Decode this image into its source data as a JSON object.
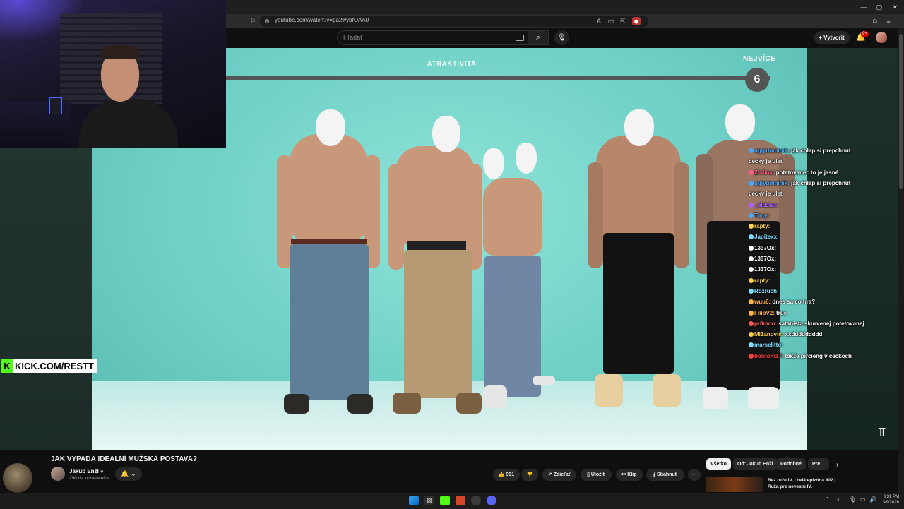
{
  "browser": {
    "url": "youtube.com/watch?v=ga2wybfOAA0",
    "window_controls": [
      "—",
      "▢",
      "✕"
    ]
  },
  "youtube": {
    "search_placeholder": "Hľadať",
    "create_label": "Vytvoriť",
    "notifications_badge": "9+"
  },
  "video": {
    "bar_label": "ATRAKTIVITA",
    "bar_top_label": "NEJVÍCE",
    "rank_number": "6",
    "title": "JAK VYPADÁ IDEÁLNÍ MUŽSKÁ POSTAVA?",
    "channel_name": "Jakub Enžl",
    "subscribers": "290 tis. odberateľov",
    "likes": "991",
    "actions": {
      "share": "Zdieľať",
      "save": "Uložiť",
      "clip": "Klip",
      "download": "Stiahnuť"
    }
  },
  "stream_overlay": {
    "kick_label": "KICK.COM/RESTT"
  },
  "chat": [
    {
      "user": "uglydominik:",
      "text": "jak chlap si prepchnut",
      "color": "#4aa8ff"
    },
    {
      "user": "",
      "text": "cecky je ulet",
      "color": "#ffffff"
    },
    {
      "user": "Ziolina:",
      "text": "potetovanec to je jasné",
      "color": "#ff5a8a"
    },
    {
      "user": "uglydominik:",
      "text": "jak chlap si prepchnut",
      "color": "#4aa8ff"
    },
    {
      "user": "",
      "text": "cecky je ulet",
      "color": "#ffffff"
    },
    {
      "user": "_oldstar:",
      "text": "",
      "color": "#b060ff"
    },
    {
      "user": "Tony:",
      "text": "",
      "color": "#4aa8ff"
    },
    {
      "user": "rapty:",
      "text": "",
      "color": "#ffd24a"
    },
    {
      "user": "Japitexx:",
      "text": "",
      "color": "#7fe0ff"
    },
    {
      "user": "1337Ox:",
      "text": "",
      "color": "#ffffff"
    },
    {
      "user": "1337Ox:",
      "text": "",
      "color": "#ffffff"
    },
    {
      "user": "1337Ox:",
      "text": "",
      "color": "#ffffff"
    },
    {
      "user": "rapty:",
      "text": "",
      "color": "#ffd24a"
    },
    {
      "user": "Rozruch:",
      "text": "",
      "color": "#7fe0ff"
    },
    {
      "user": "wuu6:",
      "text": "dnes sa co hra?",
      "color": "#ffb347"
    },
    {
      "user": "FilipV2:",
      "text": "true",
      "color": "#ffb347"
    },
    {
      "user": "pr0moo:",
      "text": "satanista skurvenej potetovanej",
      "color": "#ff5a5a"
    },
    {
      "user": "Mi1anovic:",
      "text": "xxddddddddd",
      "color": "#ffd24a"
    },
    {
      "user": "marselitto:",
      "text": "",
      "color": "#7fe0ff"
    },
    {
      "user": "boritom17:",
      "text": "takže pirciéng v ceckoch",
      "color": "#ff4040"
    }
  ],
  "filter_chips": [
    "Všetko",
    "Od: Jakub Enžl",
    "Podobné",
    "Pre vás"
  ],
  "recommendation": {
    "title": "Bez ruže IV. | celá epizóda #02 | Ruža pre nevestu IV."
  },
  "taskbar": {
    "time": "8:31 PM",
    "date": "3/9/2026"
  },
  "colors": {
    "accent_green": "#53fc18",
    "video_bg": "#6ed0c6",
    "youtube_red": "#cc0000"
  }
}
